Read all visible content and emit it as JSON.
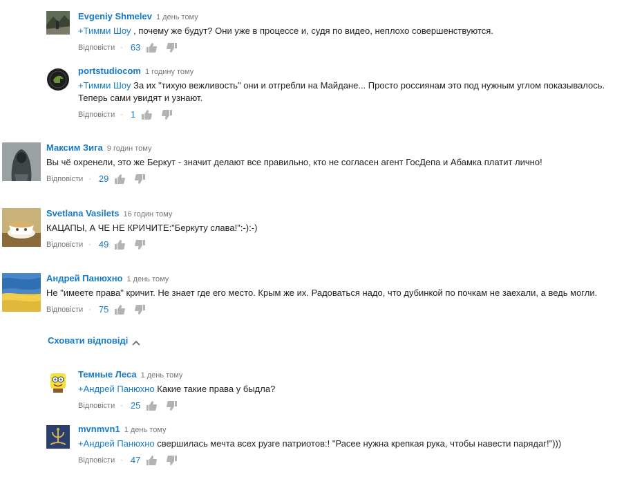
{
  "comments": [
    {
      "id": "c1",
      "author": "Evgeniy Shmelev",
      "time": "1 день тому",
      "mention": "+Тимми Шоу",
      "text": " , почему же будут? Они уже в процессе и, судя по видео, неплохо совершенствуются.",
      "reply_label": "Відповісти",
      "likes": "63",
      "avatar": "mountain-photo-avatar"
    },
    {
      "id": "c2",
      "author": "portstudiocom",
      "time": "1 годину тому",
      "mention": "+Тимми Шоу",
      "text": " За их \"тихую вежливость\" они и отгребли на Майдане... Просто россиянам это под нужным углом показывалось. Теперь сами увидят и узнают.",
      "reply_label": "Відповісти",
      "likes": "1",
      "avatar": "dark-logo-avatar"
    },
    {
      "id": "c3",
      "author": "Максим Зига",
      "time": "9 годин тому",
      "mention": "",
      "text": "Вы чё охренели, это же Беркут - значит делают все правильно, кто не согласен агент ГосДепа и Абамка платит лично!",
      "reply_label": "Відповісти",
      "likes": "29",
      "avatar": "hooded-figure-avatar"
    },
    {
      "id": "c4",
      "author": "Svetlana Vasilets",
      "time": "16 годин тому",
      "mention": "",
      "text": "КАЦАПЫ, А ЧЕ НЕ КРИЧИТЕ:\"Беркуту слава!\":-):-)",
      "reply_label": "Відповісти",
      "likes": "49",
      "avatar": "teacup-avatar"
    },
    {
      "id": "c5",
      "author": "Андрей Панюхно",
      "time": "1 день тому",
      "mention": "",
      "text": "Не \"имеете права\" кричит. Не знает где его место. Крым же их. Радоваться надо, что дубинкой по почкам не заехали, а ведь могли.",
      "reply_label": "Відповісти",
      "likes": "75",
      "avatar": "ukraine-flag-avatar"
    },
    {
      "id": "c6",
      "author": "Темные Леса",
      "time": "1 день тому",
      "mention": "+Андрей Панюхно",
      "text": " Какие такие права у быдла?",
      "reply_label": "Відповісти",
      "likes": "25",
      "avatar": "cartoon-sponge-avatar"
    },
    {
      "id": "c7",
      "author": "mvnmvn1",
      "time": "1 день тому",
      "mention": "+Андрей Панюхно",
      "text": " свершилась мечта всех рузге патриотов:! \"Расее нужна крепкая рука, чтобы навести парядаг!\")))",
      "reply_label": "Відповісти",
      "likes": "47",
      "avatar": "gold-emblem-avatar"
    }
  ],
  "hide_replies_label": "Сховати відповіді",
  "dot": "·",
  "colors": {
    "link": "#167ac6",
    "meta": "#767676",
    "icon": "#b3b3b3"
  }
}
